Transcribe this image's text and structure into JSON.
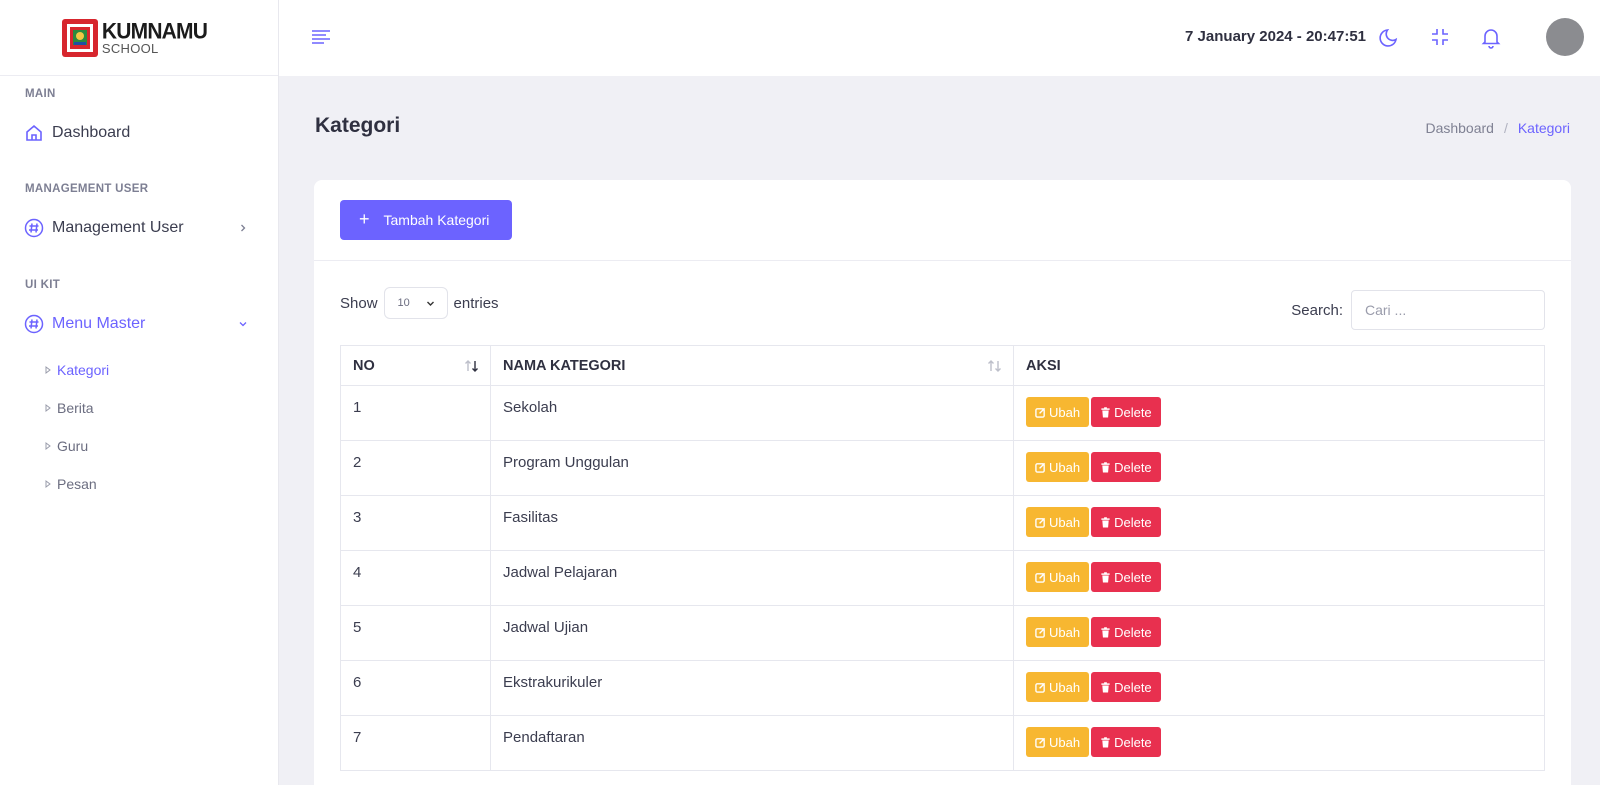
{
  "brand": {
    "line1": "KUMNAMU",
    "line2": "SCHOOL"
  },
  "sidebar": {
    "sections": [
      {
        "label": "MAIN"
      },
      {
        "label": "MANAGEMENT USER"
      },
      {
        "label": "UI KIT"
      }
    ],
    "items": [
      {
        "label": "Dashboard",
        "icon": "home-icon"
      },
      {
        "label": "Management User",
        "icon": "hash-icon"
      },
      {
        "label": "Menu Master",
        "icon": "hash-icon"
      }
    ],
    "subitems": [
      {
        "label": "Kategori"
      },
      {
        "label": "Berita"
      },
      {
        "label": "Guru"
      },
      {
        "label": "Pesan"
      }
    ]
  },
  "topbar": {
    "datetime": "7 January 2024 - 20:47:51"
  },
  "page": {
    "title": "Kategori",
    "breadcrumb": {
      "home": "Dashboard",
      "separator": "/",
      "current": "Kategori"
    }
  },
  "toolbar": {
    "add_label": "Tambah Kategori"
  },
  "datatable": {
    "show_label": "Show",
    "length_value": "10",
    "entries_label": "entries",
    "search_label": "Search:",
    "search_placeholder": "Cari ...",
    "columns": [
      "NO",
      "NAMA KATEGORI",
      "AKSI"
    ],
    "edit_label": "Ubah",
    "delete_label": "Delete",
    "rows": [
      {
        "no": "1",
        "name": "Sekolah"
      },
      {
        "no": "2",
        "name": "Program Unggulan"
      },
      {
        "no": "3",
        "name": "Fasilitas"
      },
      {
        "no": "4",
        "name": "Jadwal Pelajaran"
      },
      {
        "no": "5",
        "name": "Jadwal Ujian"
      },
      {
        "no": "6",
        "name": "Ekstrakurikuler"
      },
      {
        "no": "7",
        "name": "Pendaftaran"
      }
    ]
  },
  "colors": {
    "accent": "#6c63ff",
    "warning": "#f7b731",
    "danger": "#e8304f"
  }
}
